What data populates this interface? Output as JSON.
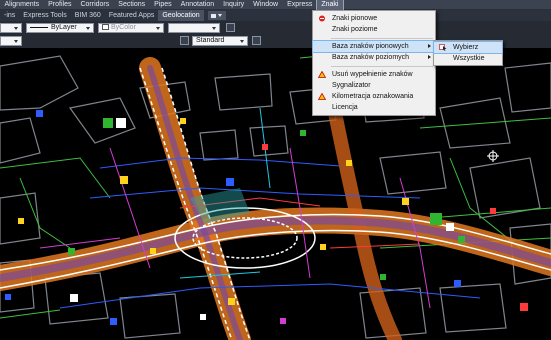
{
  "menubar": {
    "items": [
      "Alignments",
      "Profiles",
      "Corridors",
      "Sections",
      "Pipes",
      "Annotation",
      "Inquiry",
      "Window",
      "Express",
      "Znaki"
    ],
    "active": "Znaki"
  },
  "ribbon_tabs": {
    "items": [
      "-ins",
      "Express Tools",
      "BIM 360",
      "Featured Apps",
      "Geolocation"
    ],
    "active": "Geolocation"
  },
  "properties": {
    "linetype": "ByLayer",
    "color": "ByColor",
    "style": "Standard"
  },
  "znaki_menu": {
    "items": [
      {
        "label": "Znaki pionowe",
        "icon": "vertical-sign-icon",
        "has_submenu": false
      },
      {
        "label": "Znaki poziome",
        "icon": "",
        "has_submenu": false
      },
      {
        "label": "Baza znaków pionowych",
        "icon": "",
        "has_submenu": true,
        "highlighted": true
      },
      {
        "label": "Baza znaków poziomych",
        "icon": "",
        "has_submenu": true
      },
      {
        "label": "Usuń wypełnienie znaków",
        "icon": "warning-sign-icon",
        "has_submenu": false
      },
      {
        "label": "Sygnalizator",
        "icon": "",
        "has_submenu": false
      },
      {
        "label": "Kilometracja oznakowania",
        "icon": "warning-sign-icon",
        "has_submenu": false
      },
      {
        "label": "Licencja",
        "icon": "",
        "has_submenu": false
      }
    ]
  },
  "submenu": {
    "items": [
      {
        "label": "Wybierz",
        "icon": "pick-sign-icon",
        "highlighted": true
      },
      {
        "label": "Wszystkie",
        "icon": "",
        "highlighted": false
      }
    ]
  },
  "colors": {
    "menu_bg": "#f0f0f0",
    "highlight": "#cfe3f8",
    "canvas_bg": "#000000",
    "road_orange": "#e0781e",
    "lines_green": "#3fbf3f",
    "lines_blue": "#2e5cff",
    "lines_magenta": "#d23cd2"
  }
}
